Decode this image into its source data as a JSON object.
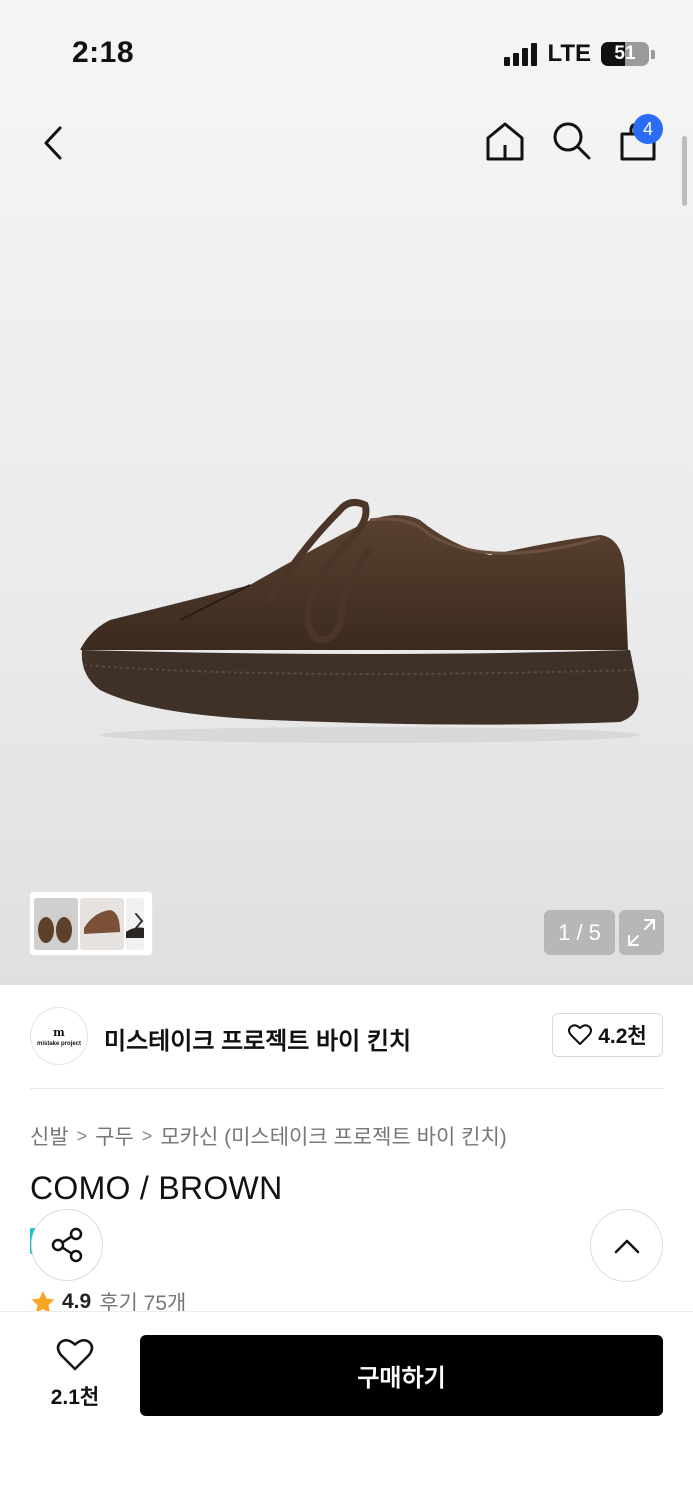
{
  "status_bar": {
    "time": "2:18",
    "network": "LTE",
    "battery": "51"
  },
  "nav": {
    "cart_count": "4"
  },
  "gallery": {
    "page_counter": "1 / 5"
  },
  "brand": {
    "logo_line1": "m",
    "logo_line2": "mistake project",
    "name": "미스테이크 프로젝트 바이 킨치",
    "like_count": "4.2천"
  },
  "breadcrumb": [
    "신발",
    "구두",
    "모카신 (미스테이크 프로젝트 바이 킨치)"
  ],
  "product": {
    "title": "COMO / BROWN",
    "rating": "4.9",
    "review_label": "후기 75개"
  },
  "bottom_bar": {
    "wish_count": "2.1천",
    "buy_label": "구매하기"
  },
  "colors": {
    "accent_badge": "#2b6cf5",
    "buy_button": "#000000",
    "star": "#f5a623",
    "tag": "#18c1d6"
  },
  "icons": [
    "back-icon",
    "home-icon",
    "search-icon",
    "bag-icon",
    "chevron-right-icon",
    "expand-icon",
    "heart-icon",
    "share-icon",
    "chevron-up-icon",
    "star-icon"
  ]
}
